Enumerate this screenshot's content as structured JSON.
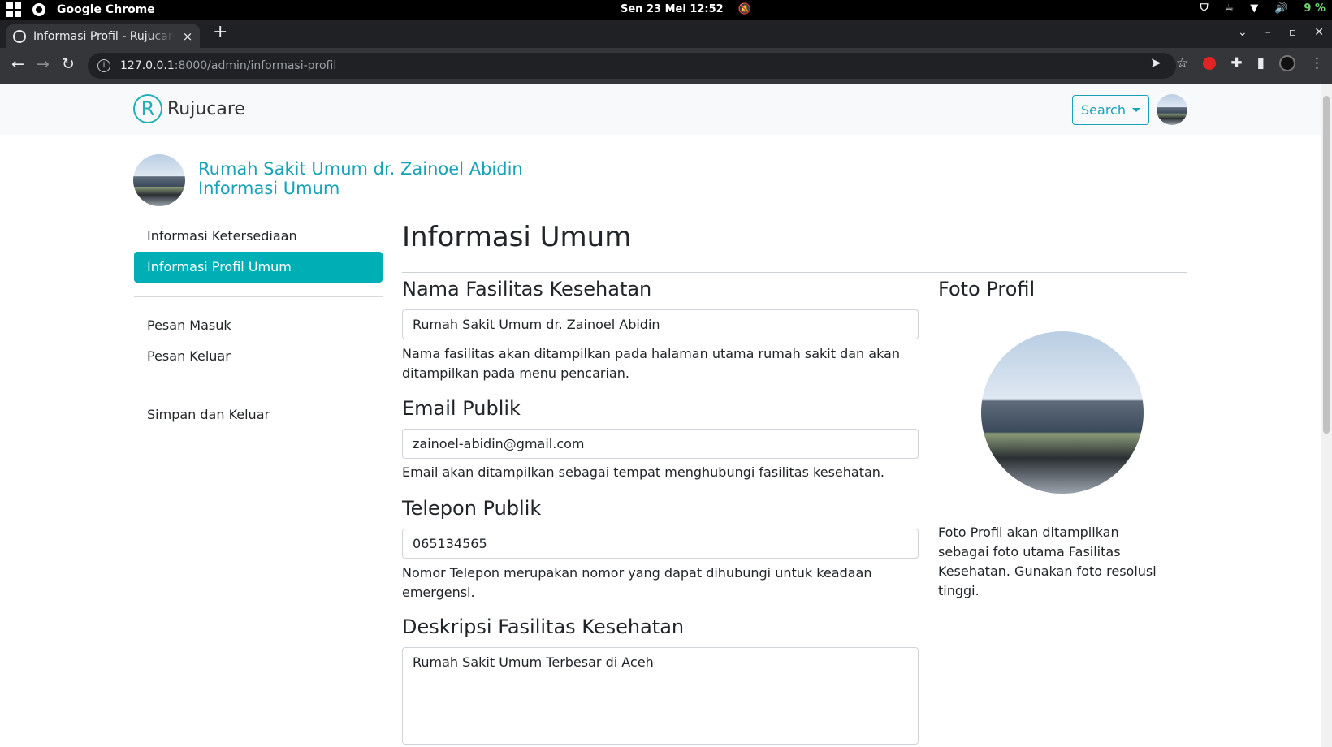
{
  "os": {
    "app_name": "Google Chrome",
    "datetime": "Sen 23 Mei  12:52",
    "battery": "9 %"
  },
  "browser": {
    "tab_title": "Informasi Profil - Rujucare",
    "tab_close": "×",
    "new_tab": "+",
    "url_host": "127.0.0.1",
    "url_path": ":8000/admin/informasi-profil",
    "window_controls": [
      "⌄",
      "–",
      "▫",
      "✕"
    ]
  },
  "navbar": {
    "brand_letter": "R",
    "brand_name": "Rujucare",
    "search_label": "Search"
  },
  "header": {
    "hospital_name": "Rumah Sakit Umum dr. Zainoel Abidin",
    "section_name": "Informasi Umum"
  },
  "sidebar": {
    "group1": [
      "Informasi Ketersediaan",
      "Informasi Profil Umum"
    ],
    "group2": [
      "Pesan Masuk",
      "Pesan Keluar"
    ],
    "group3": [
      "Simpan dan Keluar"
    ]
  },
  "main": {
    "title": "Informasi Umum",
    "fields": {
      "name": {
        "label": "Nama Fasilitas Kesehatan",
        "value": "Rumah Sakit Umum dr. Zainoel Abidin",
        "help": "Nama fasilitas akan ditampilkan pada halaman utama rumah sakit dan akan ditampilkan pada menu pencarian."
      },
      "email": {
        "label": "Email Publik",
        "value": "zainoel-abidin@gmail.com",
        "help": "Email akan ditampilkan sebagai tempat menghubungi fasilitas kesehatan."
      },
      "phone": {
        "label": "Telepon Publik",
        "value": "065134565",
        "help": "Nomor Telepon merupakan nomor yang dapat dihubungi untuk keadaan emergensi."
      },
      "description": {
        "label": "Deskripsi Fasilitas Kesehatan",
        "value": "Rumah Sakit Umum Terbesar di Aceh"
      }
    },
    "photo": {
      "label": "Foto Profil",
      "help": "Foto Profil akan ditampilkan sebagai foto utama Fasilitas Kesehatan. Gunakan foto resolusi tinggi."
    }
  },
  "colors": {
    "accent": "#17a2b8",
    "active_bg": "#00aeb5"
  }
}
